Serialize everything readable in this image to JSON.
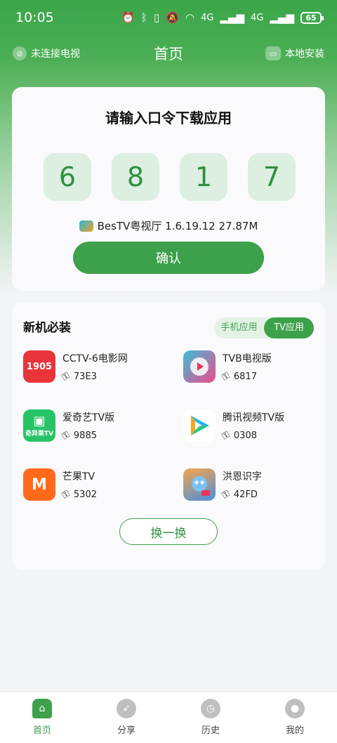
{
  "status": {
    "time": "10:05",
    "network_labels": [
      "4G",
      "4G"
    ],
    "battery": "65"
  },
  "topbar": {
    "left_label": "未连接电视",
    "title": "首页",
    "right_label": "本地安装"
  },
  "code_card": {
    "title": "请输入口令下载应用",
    "digits": [
      "6",
      "8",
      "1",
      "7"
    ],
    "app_info": "BesTV粤视厅 1.6.19.12 27.87M",
    "confirm_label": "确认"
  },
  "apps_card": {
    "title": "新机必装",
    "tabs": [
      {
        "label": "手机应用",
        "active": false
      },
      {
        "label": "TV应用",
        "active": true
      }
    ],
    "apps": [
      {
        "name": "CCTV-6电影网",
        "code": "73E3",
        "logo_text": "1905",
        "color": "#e9343a"
      },
      {
        "name": "TVB电视版",
        "code": "6817",
        "logo_text": "",
        "color": "#3bbdd8"
      },
      {
        "name": "爱奇艺TV版",
        "code": "9885",
        "logo_text": "奇异果TV",
        "color": "#27c467"
      },
      {
        "name": "腾讯视频TV版",
        "code": "0308",
        "logo_text": "",
        "color": "#ffffff"
      },
      {
        "name": "芒果TV",
        "code": "5302",
        "logo_text": "M",
        "color": "#ff6a1a"
      },
      {
        "name": "洪恩识字",
        "code": "42FD",
        "logo_text": "",
        "color": "#4a8fe0"
      }
    ],
    "shuffle_label": "换一换"
  },
  "bottom_nav": [
    {
      "label": "首页",
      "icon": "home-icon",
      "active": true
    },
    {
      "label": "分享",
      "icon": "compass-icon",
      "active": false
    },
    {
      "label": "历史",
      "icon": "clock-icon",
      "active": false
    },
    {
      "label": "我的",
      "icon": "user-icon",
      "active": false
    }
  ],
  "colors": {
    "accent": "#3da04b",
    "code_box_bg": "#dcefe0"
  }
}
